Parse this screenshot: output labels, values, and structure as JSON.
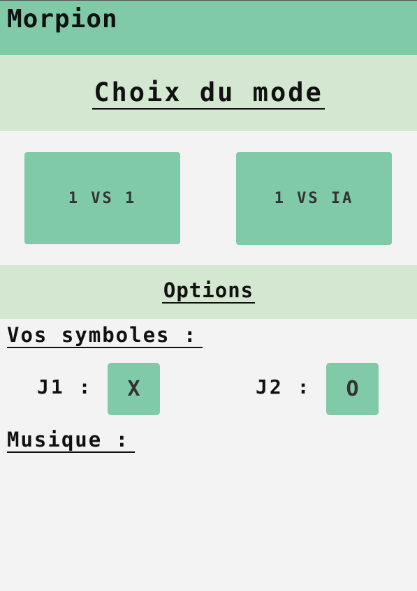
{
  "header": {
    "title": "Morpion"
  },
  "mode": {
    "title": "Choix du mode",
    "buttons": [
      "1 VS 1",
      "1 VS IA"
    ]
  },
  "options": {
    "title": "Options",
    "symbols_label": "Vos symboles :",
    "player1": {
      "label": "J1 :",
      "symbol": "X"
    },
    "player2": {
      "label": "J2 :",
      "symbol": "O"
    },
    "music_label": "Musique :"
  },
  "colors": {
    "accent": "#80caa8",
    "band": "#d4e7d0",
    "background": "#f3f3f3",
    "text": "#111111"
  }
}
